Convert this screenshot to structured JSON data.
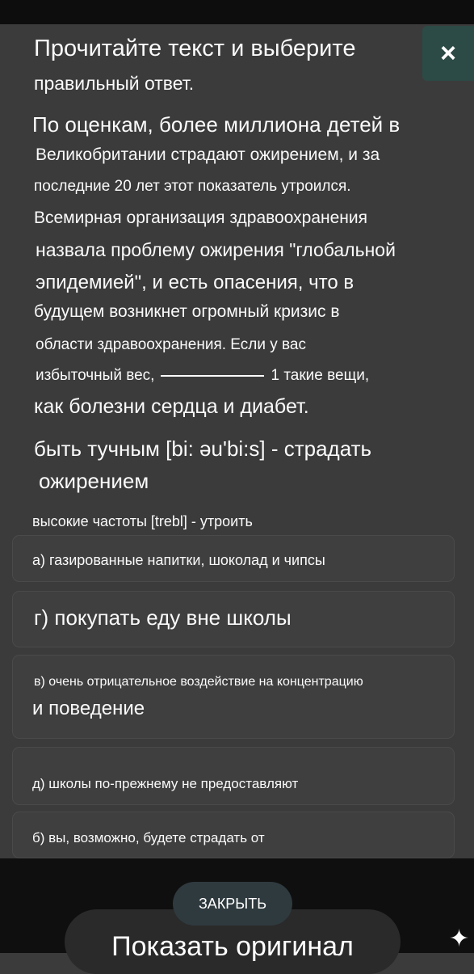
{
  "dialog": {
    "title_line1": "Прочитайте текст и выберите",
    "title_line2": "правильный ответ.",
    "close_icon": "×"
  },
  "passage": {
    "line1": "По оценкам, более миллиона детей в",
    "line2": "Великобритании страдают ожирением, и за",
    "line3": "последние 20 лет этот показатель утроился.",
    "line4": "Всемирная организация здравоохранения",
    "line5": "назвала проблему ожирения \"глобальной",
    "line6": "эпидемией\", и есть опасения, что в",
    "line7": "будущем возникнет огромный кризис в",
    "line8": "области здравоохранения. Если у вас",
    "line9_start": "избыточный вес,",
    "line9_end": "1 такие вещи,",
    "line10": "как болезни сердца и диабет."
  },
  "glossary": {
    "entry1_line1": "быть тучным [bi: əu'bi:s] - страдать",
    "entry1_line2": "ожирением",
    "entry2": "высокие частоты [trebl] - утроить"
  },
  "options": [
    {
      "label": "а) газированные напитки, шоколад и чипсы"
    },
    {
      "label": "г) покупать еду вне школы"
    },
    {
      "label_line1": "в) очень отрицательное воздействие на концентрацию",
      "label_line2": "и поведение"
    },
    {
      "label": "д) школы по-прежнему не предоставляют"
    },
    {
      "label": "б) вы, возможно, будете страдать от"
    }
  ],
  "bottom": {
    "dismiss_label": "ЗАКРЫТЬ",
    "show_original_label": "Показать оригинал"
  },
  "colors": {
    "background": "#3b3b3b",
    "close_button": "#2c4a46",
    "dismiss_button": "#2f3a3f"
  }
}
